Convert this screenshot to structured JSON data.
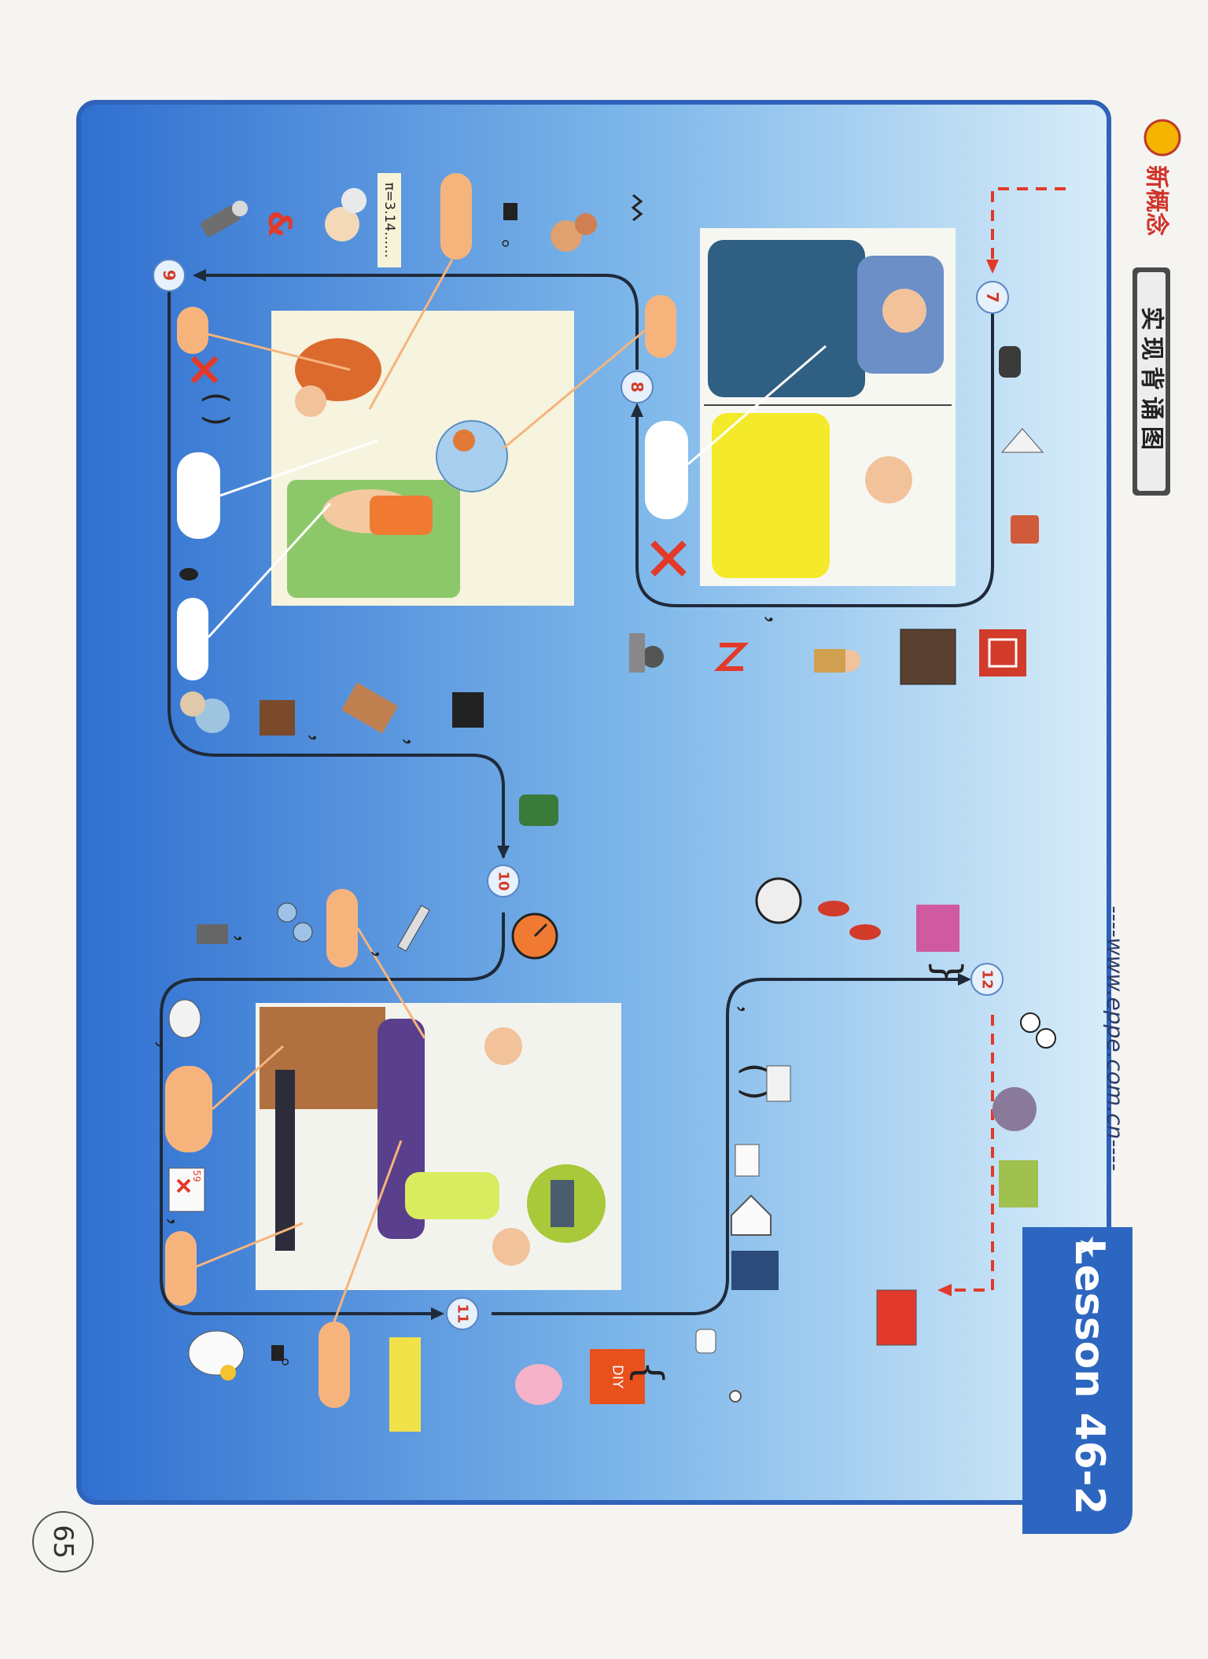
{
  "page": {
    "page_number": "65",
    "lesson_title": "Lesson 46-2",
    "lesson_star": "★",
    "website": "----www.eppe.com.cn----",
    "section_title": "实现背诵图",
    "brand": "新概念"
  },
  "steps": {
    "s7": "7",
    "s8": "8",
    "s9": "9",
    "s10": "10",
    "s11": "11",
    "s12": "12"
  },
  "labels": {
    "pi_formula": "π=3.14……",
    "score_59": "59",
    "diy": "DIY",
    "brace_left": "{",
    "brace_right": "}",
    "paren_pair": "( )",
    "comma": "，",
    "period": "。"
  },
  "colors": {
    "panel_blue": "#3f86d8",
    "panel_light": "#bfe0f6",
    "bubble_orange": "#f6b47c",
    "bubble_white": "#ffffff",
    "path_dark": "#1f2a3a",
    "accent_red": "#e23a2a",
    "lesson_bg": "#2d66c0"
  }
}
